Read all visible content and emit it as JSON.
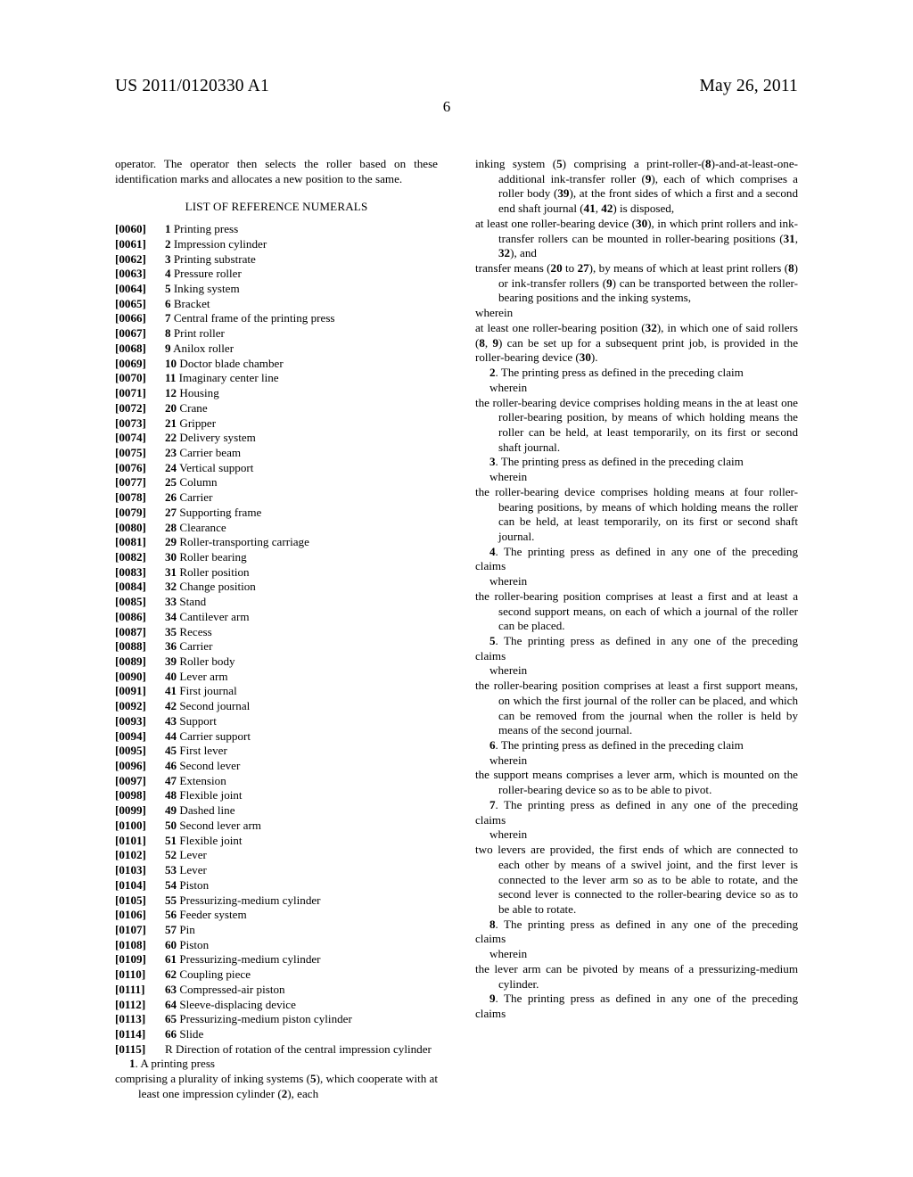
{
  "header": {
    "publication_number": "US 2011/0120330 A1",
    "publication_date": "May 26, 2011",
    "page_number": "6"
  },
  "left_column": {
    "top_paragraph": "operator. The operator then selects the roller based on these identification marks and allocates a new position to the same.",
    "section_heading": "LIST OF REFERENCE NUMERALS",
    "reference_numerals": [
      {
        "para": "[0060]",
        "num": "1",
        "label": "Printing press"
      },
      {
        "para": "[0061]",
        "num": "2",
        "label": "Impression cylinder"
      },
      {
        "para": "[0062]",
        "num": "3",
        "label": "Printing substrate"
      },
      {
        "para": "[0063]",
        "num": "4",
        "label": "Pressure roller"
      },
      {
        "para": "[0064]",
        "num": "5",
        "label": "Inking system"
      },
      {
        "para": "[0065]",
        "num": "6",
        "label": "Bracket"
      },
      {
        "para": "[0066]",
        "num": "7",
        "label": "Central frame of the printing press"
      },
      {
        "para": "[0067]",
        "num": "8",
        "label": "Print roller"
      },
      {
        "para": "[0068]",
        "num": "9",
        "label": "Anilox roller"
      },
      {
        "para": "[0069]",
        "num": "10",
        "label": "Doctor blade chamber"
      },
      {
        "para": "[0070]",
        "num": "11",
        "label": "Imaginary center line"
      },
      {
        "para": "[0071]",
        "num": "12",
        "label": "Housing"
      },
      {
        "para": "[0072]",
        "num": "20",
        "label": "Crane"
      },
      {
        "para": "[0073]",
        "num": "21",
        "label": "Gripper"
      },
      {
        "para": "[0074]",
        "num": "22",
        "label": "Delivery system"
      },
      {
        "para": "[0075]",
        "num": "23",
        "label": "Carrier beam"
      },
      {
        "para": "[0076]",
        "num": "24",
        "label": "Vertical support"
      },
      {
        "para": "[0077]",
        "num": "25",
        "label": "Column"
      },
      {
        "para": "[0078]",
        "num": "26",
        "label": "Carrier"
      },
      {
        "para": "[0079]",
        "num": "27",
        "label": "Supporting frame"
      },
      {
        "para": "[0080]",
        "num": "28",
        "label": "Clearance"
      },
      {
        "para": "[0081]",
        "num": "29",
        "label": "Roller-transporting carriage"
      },
      {
        "para": "[0082]",
        "num": "30",
        "label": "Roller bearing"
      },
      {
        "para": "[0083]",
        "num": "31",
        "label": "Roller position"
      },
      {
        "para": "[0084]",
        "num": "32",
        "label": "Change position"
      },
      {
        "para": "[0085]",
        "num": "33",
        "label": "Stand"
      },
      {
        "para": "[0086]",
        "num": "34",
        "label": "Cantilever arm"
      },
      {
        "para": "[0087]",
        "num": "35",
        "label": "Recess"
      },
      {
        "para": "[0088]",
        "num": "36",
        "label": "Carrier"
      },
      {
        "para": "[0089]",
        "num": "39",
        "label": "Roller body"
      },
      {
        "para": "[0090]",
        "num": "40",
        "label": "Lever arm"
      },
      {
        "para": "[0091]",
        "num": "41",
        "label": "First journal"
      },
      {
        "para": "[0092]",
        "num": "42",
        "label": "Second journal"
      },
      {
        "para": "[0093]",
        "num": "43",
        "label": "Support"
      },
      {
        "para": "[0094]",
        "num": "44",
        "label": "Carrier support"
      },
      {
        "para": "[0095]",
        "num": "45",
        "label": "First lever"
      },
      {
        "para": "[0096]",
        "num": "46",
        "label": "Second lever"
      },
      {
        "para": "[0097]",
        "num": "47",
        "label": "Extension"
      },
      {
        "para": "[0098]",
        "num": "48",
        "label": "Flexible joint"
      },
      {
        "para": "[0099]",
        "num": "49",
        "label": "Dashed line"
      },
      {
        "para": "[0100]",
        "num": "50",
        "label": "Second lever arm"
      },
      {
        "para": "[0101]",
        "num": "51",
        "label": "Flexible joint"
      },
      {
        "para": "[0102]",
        "num": "52",
        "label": "Lever"
      },
      {
        "para": "[0103]",
        "num": "53",
        "label": "Lever"
      },
      {
        "para": "[0104]",
        "num": "54",
        "label": "Piston"
      },
      {
        "para": "[0105]",
        "num": "55",
        "label": "Pressurizing-medium cylinder"
      },
      {
        "para": "[0106]",
        "num": "56",
        "label": "Feeder system"
      },
      {
        "para": "[0107]",
        "num": "57",
        "label": "Pin"
      },
      {
        "para": "[0108]",
        "num": "60",
        "label": "Piston"
      },
      {
        "para": "[0109]",
        "num": "61",
        "label": "Pressurizing-medium cylinder"
      },
      {
        "para": "[0110]",
        "num": "62",
        "label": "Coupling piece"
      },
      {
        "para": "[0111]",
        "num": "63",
        "label": "Compressed-air piston"
      },
      {
        "para": "[0112]",
        "num": "64",
        "label": "Sleeve-displacing device"
      },
      {
        "para": "[0113]",
        "num": "65",
        "label": "Pressurizing-medium piston cylinder"
      },
      {
        "para": "[0114]",
        "num": "66",
        "label": "Slide"
      }
    ],
    "reference_numeral_last": {
      "para": "[0115]",
      "num": "R",
      "label": "Direction of rotation of the central impression cylinder"
    },
    "claim1_head_number": "1",
    "claim1_head_text": ". A printing press",
    "claim1_body_start": "comprising a plurality of inking systems (5), which cooperate with at least one impression cylinder (2), each"
  },
  "right_column": {
    "claim1_continued_1": "inking system (5) comprising a print-roller-(8)-and-at-least-one-additional ink-transfer roller (9), each of which comprises a roller body (39), at the front sides of which a first and a second end shaft journal (41, 42) is disposed,",
    "claim1_continued_2": "at least one roller-bearing device (30), in which print rollers and ink-transfer rollers can be mounted in roller-bearing positions (31, 32), and",
    "claim1_continued_3": "transfer means (20 to 27), by means of which at least print rollers (8) or ink-transfer rollers (9) can be transported between the roller-bearing positions and the inking systems,",
    "claim1_wherein": "wherein",
    "claim1_final": "at least one roller-bearing position (32), in which one of said rollers (8, 9) can be set up for a subsequent print job, is provided in the roller-bearing device (30).",
    "claims": [
      {
        "number": "2",
        "head": ". The printing press as defined in the preceding claim",
        "wherein": "wherein",
        "body": "the roller-bearing device comprises holding means in the at least one roller-bearing position, by means of which holding means the roller can be held, at least temporarily, on its first or second shaft journal."
      },
      {
        "number": "3",
        "head": ". The printing press as defined in the preceding claim",
        "wherein": "wherein",
        "body": "the roller-bearing device comprises holding means at four roller-bearing positions, by means of which holding means the roller can be held, at least temporarily, on its first or second shaft journal."
      },
      {
        "number": "4",
        "head": ". The printing press as defined in any one of the preceding claims",
        "wherein": "wherein",
        "body": "the roller-bearing position comprises at least a first and at least a second support means, on each of which a journal of the roller can be placed."
      },
      {
        "number": "5",
        "head": ". The printing press as defined in any one of the preceding claims",
        "wherein": "wherein",
        "body": "the roller-bearing position comprises at least a first support means, on which the first journal of the roller can be placed, and which can be removed from the journal when the roller is held by means of the second journal."
      },
      {
        "number": "6",
        "head": ". The printing press as defined in the preceding claim",
        "wherein": "wherein",
        "body": "the support means comprises a lever arm, which is mounted on the roller-bearing device so as to be able to pivot."
      },
      {
        "number": "7",
        "head": ". The printing press as defined in any one of the preceding claims",
        "wherein": "wherein",
        "body": "two levers are provided, the first ends of which are connected to each other by means of a swivel joint, and the first lever is connected to the lever arm so as to be able to rotate, and the second lever is connected to the roller-bearing device so as to be able to rotate."
      },
      {
        "number": "8",
        "head": ". The printing press as defined in any one of the preceding claims",
        "wherein": "wherein",
        "body": "the lever arm can be pivoted by means of a pressurizing-medium cylinder."
      },
      {
        "number": "9",
        "head": ". The printing press as defined in any one of the preceding claims",
        "wherein": "",
        "body": ""
      }
    ]
  }
}
